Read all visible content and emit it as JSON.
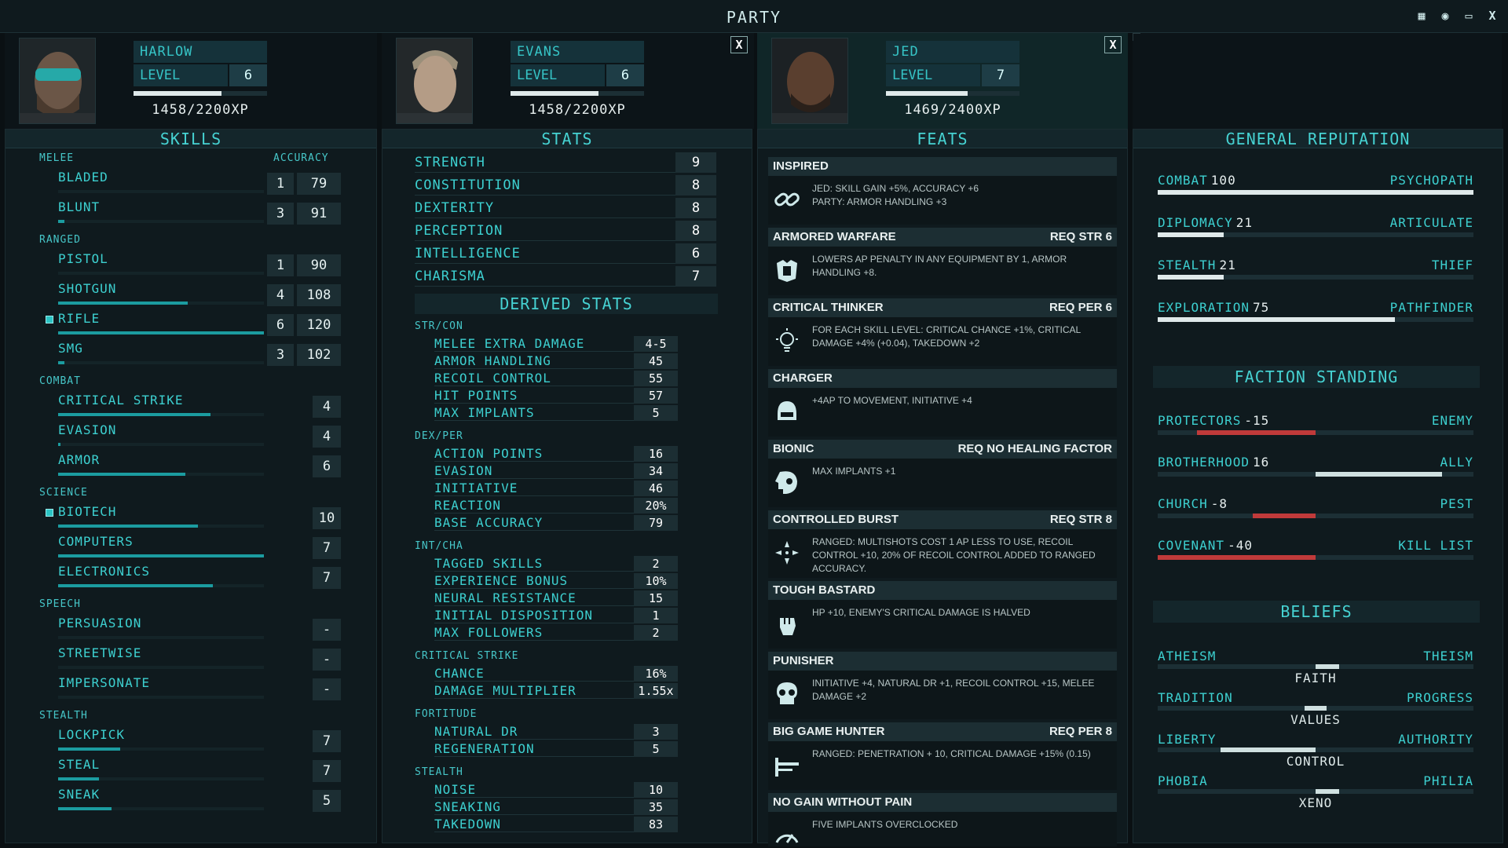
{
  "window": {
    "title": "PARTY"
  },
  "characters": [
    {
      "name": "HARLOW",
      "level_label": "LEVEL",
      "level": "6",
      "xp_text": "1458/2200XP",
      "xp_progress": 0.66,
      "closable": false
    },
    {
      "name": "EVANS",
      "level_label": "LEVEL",
      "level": "6",
      "xp_text": "1458/2200XP",
      "xp_progress": 0.66,
      "closable": true,
      "close_label": "X"
    },
    {
      "name": "JED",
      "level_label": "LEVEL",
      "level": "7",
      "xp_text": "1469/2400XP",
      "xp_progress": 0.61,
      "closable": true,
      "close_label": "X"
    }
  ],
  "skills": {
    "header": "SKILLS",
    "accuracy_label": "ACCURACY",
    "groups": [
      {
        "label": "MELEE",
        "items": [
          {
            "name": "BLADED",
            "rank": "1",
            "accuracy": "79",
            "progress": 0.0
          },
          {
            "name": "BLUNT",
            "rank": "3",
            "accuracy": "91",
            "progress": 0.03
          }
        ]
      },
      {
        "label": "RANGED",
        "items": [
          {
            "name": "PISTOL",
            "rank": "1",
            "accuracy": "90",
            "progress": 0.0
          },
          {
            "name": "SHOTGUN",
            "rank": "4",
            "accuracy": "108",
            "progress": 0.63
          },
          {
            "name": "RIFLE",
            "rank": "6",
            "accuracy": "120",
            "progress": 1.0,
            "tagged": true
          },
          {
            "name": "SMG",
            "rank": "3",
            "accuracy": "102",
            "progress": 0.03
          }
        ]
      },
      {
        "label": "COMBAT",
        "items": [
          {
            "name": "CRITICAL STRIKE",
            "rank": "4",
            "progress": 0.74
          },
          {
            "name": "EVASION",
            "rank": "4",
            "progress": 0.01
          },
          {
            "name": "ARMOR",
            "rank": "6",
            "progress": 0.62
          }
        ]
      },
      {
        "label": "SCIENCE",
        "items": [
          {
            "name": "BIOTECH",
            "rank": "10",
            "progress": 0.68,
            "tagged": true
          },
          {
            "name": "COMPUTERS",
            "rank": "7",
            "progress": 1.0
          },
          {
            "name": "ELECTRONICS",
            "rank": "7",
            "progress": 0.75
          }
        ]
      },
      {
        "label": "SPEECH",
        "items": [
          {
            "name": "PERSUASION",
            "rank": "-",
            "progress": 0.0
          },
          {
            "name": "STREETWISE",
            "rank": "-",
            "progress": 0.0
          },
          {
            "name": "IMPERSONATE",
            "rank": "-",
            "progress": 0.0
          }
        ]
      },
      {
        "label": "STEALTH",
        "items": [
          {
            "name": "LOCKPICK",
            "rank": "7",
            "progress": 0.3
          },
          {
            "name": "STEAL",
            "rank": "7",
            "progress": 0.2
          },
          {
            "name": "SNEAK",
            "rank": "5",
            "progress": 0.26
          }
        ]
      }
    ]
  },
  "stats": {
    "header": "STATS",
    "primary": [
      {
        "name": "STRENGTH",
        "value": "9"
      },
      {
        "name": "CONSTITUTION",
        "value": "8"
      },
      {
        "name": "DEXTERITY",
        "value": "8"
      },
      {
        "name": "PERCEPTION",
        "value": "8"
      },
      {
        "name": "INTELLIGENCE",
        "value": "6"
      },
      {
        "name": "CHARISMA",
        "value": "7"
      }
    ],
    "derived_header": "DERIVED STATS",
    "derived_groups": [
      {
        "label": "STR/CON",
        "items": [
          {
            "name": "MELEE EXTRA DAMAGE",
            "value": "4-5"
          },
          {
            "name": "ARMOR HANDLING",
            "value": "45"
          },
          {
            "name": "RECOIL CONTROL",
            "value": "55"
          },
          {
            "name": "HIT POINTS",
            "value": "57"
          },
          {
            "name": "MAX IMPLANTS",
            "value": "5"
          }
        ]
      },
      {
        "label": "DEX/PER",
        "items": [
          {
            "name": "ACTION POINTS",
            "value": "16"
          },
          {
            "name": "EVASION",
            "value": "34"
          },
          {
            "name": "INITIATIVE",
            "value": "46"
          },
          {
            "name": "REACTION",
            "value": "20%"
          },
          {
            "name": "BASE ACCURACY",
            "value": "79"
          }
        ]
      },
      {
        "label": "INT/CHA",
        "items": [
          {
            "name": "TAGGED SKILLS",
            "value": "2"
          },
          {
            "name": "EXPERIENCE BONUS",
            "value": "10%"
          },
          {
            "name": "NEURAL RESISTANCE",
            "value": "15"
          },
          {
            "name": "INITIAL DISPOSITION",
            "value": "1"
          },
          {
            "name": "MAX FOLLOWERS",
            "value": "2"
          }
        ]
      },
      {
        "label": "CRITICAL STRIKE",
        "items": [
          {
            "name": "CHANCE",
            "value": "16%"
          },
          {
            "name": "DAMAGE MULTIPLIER",
            "value": "1.55x"
          }
        ]
      },
      {
        "label": "FORTITUDE",
        "items": [
          {
            "name": "NATURAL DR",
            "value": "3"
          },
          {
            "name": "REGENERATION",
            "value": "5"
          }
        ]
      },
      {
        "label": "STEALTH",
        "items": [
          {
            "name": "NOISE",
            "value": "10"
          },
          {
            "name": "SNEAKING",
            "value": "35"
          },
          {
            "name": "TAKEDOWN",
            "value": "83"
          }
        ]
      }
    ]
  },
  "feats": {
    "header": "FEATS",
    "items": [
      {
        "name": "INSPIRED",
        "req": "",
        "icon": "chain-icon",
        "desc": "JED: SKILL GAIN +5%, ACCURACY +6\nPARTY: ARMOR HANDLING +3"
      },
      {
        "name": "ARMORED WARFARE",
        "req": "REQ STR 6",
        "icon": "armor-icon",
        "desc": "LOWERS AP PENALTY IN ANY EQUIPMENT BY 1, ARMOR HANDLING +8."
      },
      {
        "name": "CRITICAL THINKER",
        "req": "REQ PER 6",
        "icon": "lightbulb-icon",
        "desc": "FOR EACH SKILL LEVEL: CRITICAL CHANCE +1%, CRITICAL DAMAGE +4% (+0.04), TAKEDOWN +2"
      },
      {
        "name": "CHARGER",
        "req": "",
        "icon": "helmet-icon",
        "desc": "+4AP TO MOVEMENT, INITIATIVE +4"
      },
      {
        "name": "BIONIC",
        "req": "REQ NO HEALING FACTOR",
        "icon": "bionic-icon",
        "desc": "MAX IMPLANTS +1"
      },
      {
        "name": "CONTROLLED BURST",
        "req": "REQ STR 8",
        "icon": "crosshair-icon",
        "desc": "RANGED: MULTISHOTS COST 1 AP LESS TO USE, RECOIL CONTROL +10, 20% OF RECOIL CONTROL ADDED TO RANGED ACCURACY."
      },
      {
        "name": "TOUGH BASTARD",
        "req": "",
        "icon": "fist-icon",
        "desc": "HP +10, ENEMY'S CRITICAL DAMAGE IS HALVED"
      },
      {
        "name": "PUNISHER",
        "req": "",
        "icon": "skull-icon",
        "desc": "INITIATIVE +4, NATURAL DR +1, RECOIL CONTROL +15, MELEE DAMAGE +2"
      },
      {
        "name": "BIG GAME HUNTER",
        "req": "REQ PER 8",
        "icon": "rifle-icon",
        "desc": "RANGED: PENETRATION + 10, CRITICAL DAMAGE +15% (0.15)"
      },
      {
        "name": "NO GAIN WITHOUT PAIN",
        "req": "",
        "icon": "gauge-icon",
        "desc": "FIVE IMPLANTS OVERCLOCKED"
      }
    ]
  },
  "reputation": {
    "header": "GENERAL REPUTATION",
    "items": [
      {
        "name": "COMBAT",
        "value": "100",
        "title": "PSYCHOPATH",
        "progress": 1.0
      },
      {
        "name": "DIPLOMACY",
        "value": "21",
        "title": "ARTICULATE",
        "progress": 0.21
      },
      {
        "name": "STEALTH",
        "value": "21",
        "title": "THIEF",
        "progress": 0.21
      },
      {
        "name": "EXPLORATION",
        "value": "75",
        "title": "PATHFINDER",
        "progress": 0.75
      }
    ]
  },
  "factions": {
    "header": "FACTION STANDING",
    "items": [
      {
        "name": "PROTECTORS",
        "value": "-15",
        "title": "ENEMY",
        "value_pct": -0.75,
        "color": "#c03a3a"
      },
      {
        "name": "BROTHERHOOD",
        "value": "16",
        "title": "ALLY",
        "value_pct": 0.8,
        "color": "#cfe0e0"
      },
      {
        "name": "CHURCH",
        "value": "-8",
        "title": "PEST",
        "value_pct": -0.4,
        "color": "#c03a3a"
      },
      {
        "name": "COVENANT",
        "value": "-40",
        "title": "KILL LIST",
        "value_pct": -1.0,
        "color": "#c03a3a"
      }
    ]
  },
  "beliefs": {
    "header": "BELIEFS",
    "items": [
      {
        "left": "ATHEISM",
        "right": "THEISM",
        "label": "FAITH",
        "value_pct": 0.15
      },
      {
        "left": "TRADITION",
        "right": "PROGRESS",
        "label": "VALUES",
        "value_pct": 0.0
      },
      {
        "left": "LIBERTY",
        "right": "AUTHORITY",
        "label": "CONTROL",
        "value_pct": -0.6
      },
      {
        "left": "PHOBIA",
        "right": "PHILIA",
        "label": "XENO",
        "value_pct": 0.15
      }
    ]
  }
}
